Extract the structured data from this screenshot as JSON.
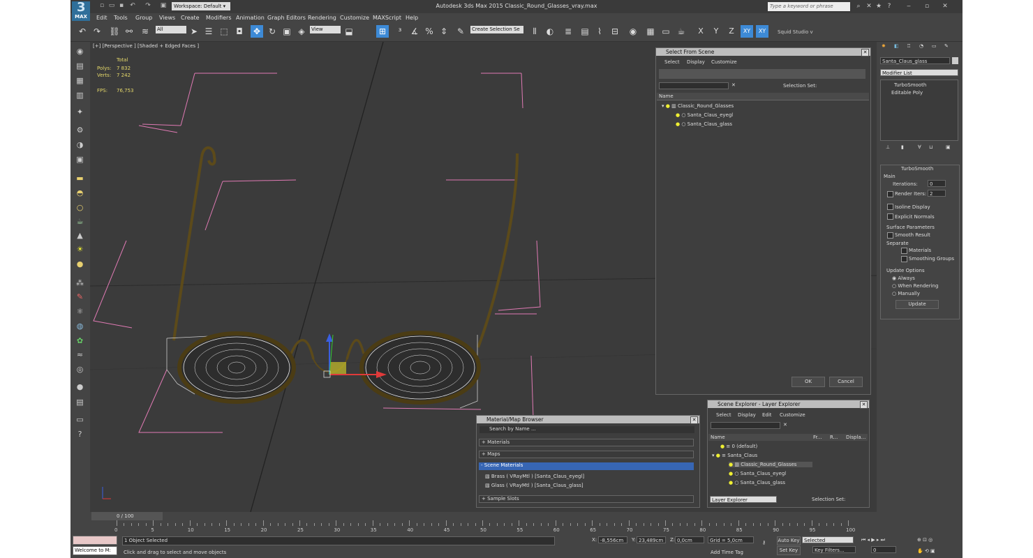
{
  "app": {
    "title": "Autodesk 3ds Max  2015     Classic_Round_Glasses_vray.max",
    "logo_label": "MAX",
    "workspace": "Workspace: Default",
    "search_placeholder": "Type a keyword or phrase"
  },
  "menus": [
    "Edit",
    "Tools",
    "Group",
    "Views",
    "Create",
    "Modifiers",
    "Animation",
    "Graph Editors",
    "Rendering",
    "Customize",
    "MAXScript",
    "Help"
  ],
  "toolbar": {
    "filter": "All",
    "ref_coord": "View",
    "selection_set": "Create Selection Se",
    "axis_labels": [
      "X",
      "Y",
      "Z",
      "XY",
      "XY"
    ],
    "studio": "Squid Studio v"
  },
  "viewport": {
    "label": "[+] [Perspective ] [Shaded + Edged Faces ]",
    "stats_header": "Total",
    "polys_label": "Polys:",
    "polys": "7 832",
    "verts_label": "Verts:",
    "verts": "7 242",
    "fps_label": "FPS:",
    "fps": "76,753"
  },
  "select_from_scene": {
    "title": "Select From Scene",
    "menus": [
      "Select",
      "Display",
      "Customize"
    ],
    "selection_set_label": "Selection Set:",
    "column": "Name",
    "items": [
      "Classic_Round_Glasses",
      "Santa_Claus_eyegl",
      "Santa_Claus_glass"
    ],
    "ok": "OK",
    "cancel": "Cancel"
  },
  "material_browser": {
    "title": "Material/Map Browser",
    "search": "Search by Name ...",
    "groups": [
      "+ Materials",
      "+ Maps",
      "- Scene Materials"
    ],
    "materials": [
      "Brass  ( VRayMtl ) [Santa_Claus_eyegl]",
      "Glass  ( VRayMtl ) [Santa_Claus_glass]"
    ],
    "sample_slots": "+ Sample Slots"
  },
  "scene_explorer": {
    "title": "Scene Explorer - Layer Explorer",
    "menus": [
      "Select",
      "Display",
      "Edit",
      "Customize"
    ],
    "columns": [
      "Name",
      "Fr...",
      "R...",
      "Displa..."
    ],
    "rows": [
      "0 (default)",
      "Santa_Claus",
      "Classic_Round_Glasses",
      "Santa_Claus_eyegl",
      "Santa_Claus_glass"
    ],
    "footer_dropdown": "Layer Explorer",
    "selection_set_label": "Selection Set:"
  },
  "command_panel": {
    "object_name": "Santa_Claus_glass",
    "modifier_list": "Modifier List",
    "stack": [
      "TurboSmooth",
      "Editable Poly"
    ],
    "rollout_title": "TurboSmooth",
    "main_label": "Main",
    "iterations_label": "Iterations:",
    "iterations": "0",
    "render_iters_label": "Render Iters:",
    "render_iters": "2",
    "isoline": "Isoline Display",
    "explicit_normals": "Explicit Normals",
    "surface_params": "Surface Parameters",
    "smooth_result": "Smooth Result",
    "separate": "Separate",
    "materials": "Materials",
    "smoothing_groups": "Smoothing Groups",
    "update_options": "Update Options",
    "always": "Always",
    "when_rendering": "When Rendering",
    "manually": "Manually",
    "update": "Update"
  },
  "timeline": {
    "frame": "0 / 100",
    "ticks": [
      "0",
      "5",
      "10",
      "15",
      "20",
      "25",
      "30",
      "35",
      "40",
      "45",
      "50",
      "55",
      "60",
      "65",
      "70",
      "75",
      "80",
      "85",
      "90",
      "95",
      "100"
    ]
  },
  "status": {
    "script": "Welcome to M:",
    "selected": "1 Object Selected",
    "prompt": "Click and drag to select and move objects",
    "x_label": "X:",
    "x": "-8,556cm",
    "y_label": "Y:",
    "y": "23,489cm",
    "z_label": "Z:",
    "z": "0,0cm",
    "grid": "Grid = 5,0cm",
    "add_time_tag": "Add Time Tag",
    "auto_key": "Auto Key",
    "set_key": "Set Key",
    "key_mode": "Selected",
    "key_filters": "Key Filters...",
    "frame_field": "0"
  }
}
